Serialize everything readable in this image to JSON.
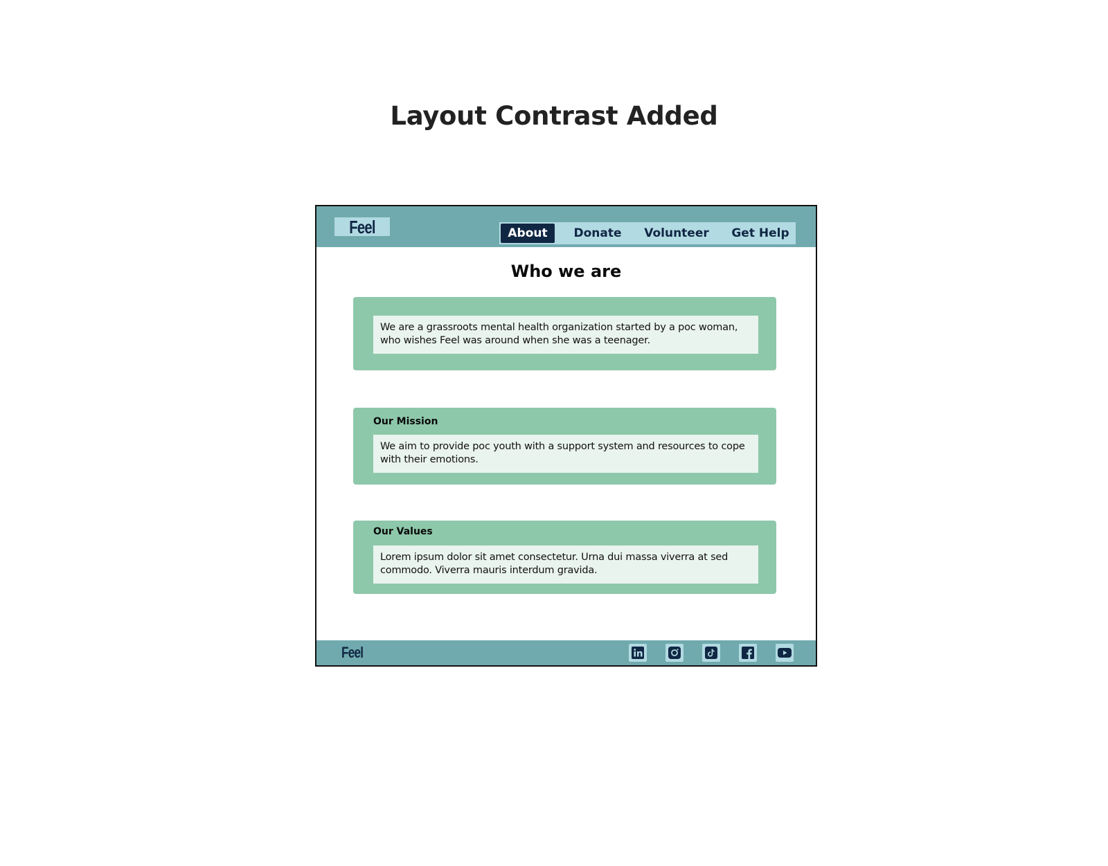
{
  "slide": {
    "title": "Layout Contrast Added"
  },
  "header": {
    "logo": "Feel",
    "nav": [
      {
        "label": "About",
        "active": true
      },
      {
        "label": "Donate",
        "active": false
      },
      {
        "label": "Volunteer",
        "active": false
      },
      {
        "label": "Get Help",
        "active": false
      }
    ]
  },
  "main": {
    "title": "Who we are",
    "intro": "We are a grassroots mental health organization started by a poc woman, who wishes Feel was around when she was a teenager.",
    "mission": {
      "heading": "Our Mission",
      "body": "We aim to provide poc youth with a support system and resources to cope with their emotions."
    },
    "values": {
      "heading": "Our Values",
      "body": "Lorem ipsum dolor sit amet consectetur. Urna dui massa viverra at sed commodo. Viverra mauris interdum gravida."
    }
  },
  "footer": {
    "logo": "Feel",
    "social_icons": [
      "linkedin-icon",
      "instagram-icon",
      "tiktok-icon",
      "facebook-icon",
      "youtube-icon"
    ]
  },
  "colors": {
    "header_bg": "#70aaae",
    "nav_bg": "#b2dae2",
    "active_bg": "#102744",
    "card_bg": "#8ec8aa",
    "card_inner_bg": "#eaf4ee"
  }
}
